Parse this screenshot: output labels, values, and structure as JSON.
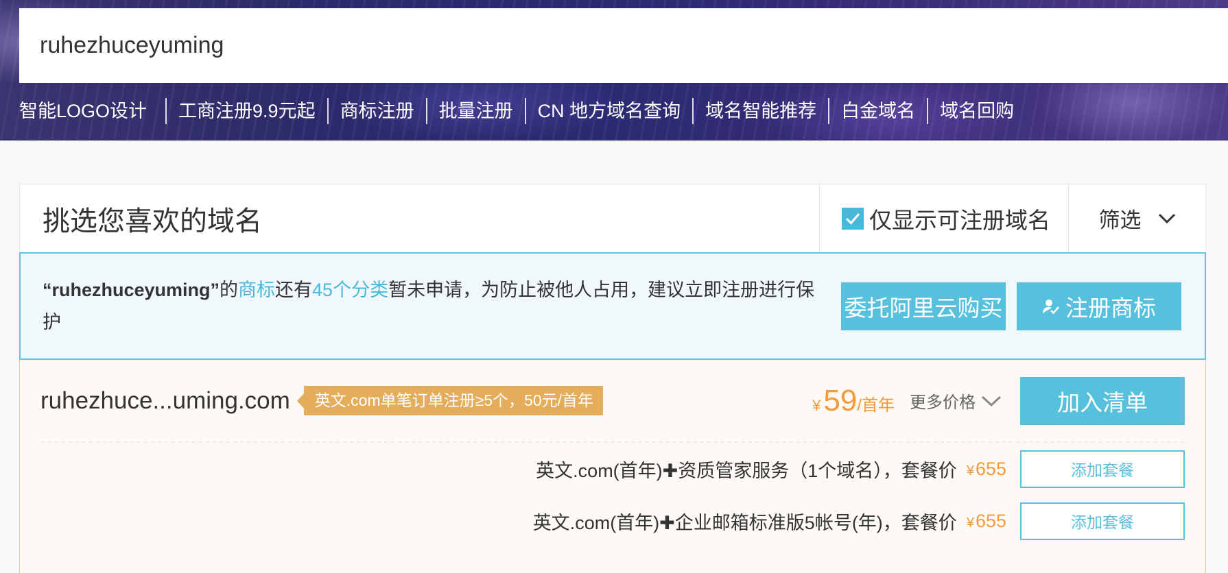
{
  "search": {
    "value": "ruhezhuceyuming"
  },
  "quick_links": [
    "智能LOGO设计",
    "工商注册9.9元起",
    "商标注册",
    "批量注册",
    "CN 地方域名查询",
    "域名智能推荐",
    "白金域名",
    "域名回购"
  ],
  "panel": {
    "title": "挑选您喜欢的域名",
    "only_available_label": "仅显示可注册域名",
    "only_available_checked": true,
    "filter_label": "筛选"
  },
  "notice": {
    "query": "“ruhezhuceyuming”",
    "text_1": "的",
    "link_trademark": "商标",
    "text_2": "还有",
    "link_categories": "45个分类",
    "text_3": "暂未申请，为防止被他人占用，建议立即注册进行保护",
    "entrust_button": "委托阿里云购买",
    "trademark_button": "注册商标"
  },
  "domain": {
    "name": "ruhezhuce...uming.com",
    "promo": "英文.com单笔订单注册≥5个，50元/首年",
    "currency": "¥",
    "price": "59",
    "unit": "/首年",
    "more_prices": "更多价格",
    "add_button": "加入清单",
    "packages": [
      {
        "text": "英文.com(首年)✚资质管家服务（1个域名），套餐价",
        "currency": "¥",
        "price": "655",
        "button": "添加套餐"
      },
      {
        "text": "英文.com(首年)✚企业邮箱标准版5帐号(年)，套餐价",
        "currency": "¥",
        "price": "655",
        "button": "添加套餐"
      }
    ]
  },
  "colors": {
    "accent": "#57c0dd",
    "price": "#f39a3a",
    "promo": "#e4ad5c"
  }
}
